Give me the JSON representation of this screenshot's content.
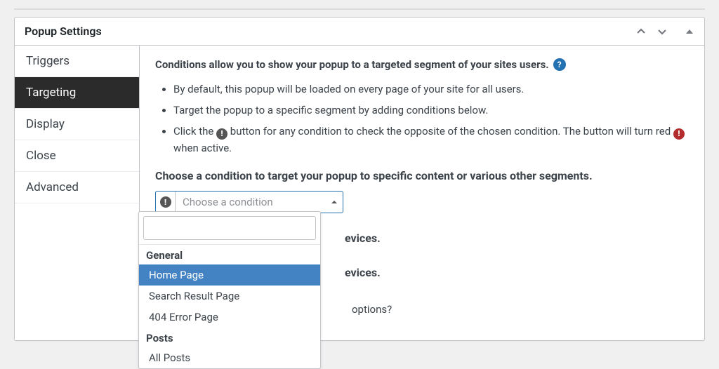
{
  "panel": {
    "title": "Popup Settings"
  },
  "tabs": {
    "items": [
      {
        "label": "Triggers"
      },
      {
        "label": "Targeting"
      },
      {
        "label": "Display"
      },
      {
        "label": "Close"
      },
      {
        "label": "Advanced"
      }
    ]
  },
  "content": {
    "intro": "Conditions allow you to show your popup to a targeted segment of your sites users.",
    "bullets": {
      "b1": "By default, this popup will be loaded on every page of your site for all users.",
      "b2": "Target the popup to a specific segment by adding conditions below.",
      "b3_a": "Click the ",
      "b3_b": " button for any condition to check the opposite of the chosen condition. The button will turn red ",
      "b3_c": " when active."
    },
    "condition_heading": "Choose a condition to target your popup to specific content or various other segments.",
    "combo_placeholder": "Choose a condition",
    "partial_line1": "evices.",
    "partial_line2": "evices.",
    "partial_line3": "options?"
  },
  "dropdown": {
    "groups": [
      {
        "label": "General",
        "options": [
          {
            "label": "Home Page",
            "selected": true
          },
          {
            "label": "Search Result Page"
          },
          {
            "label": "404 Error Page"
          }
        ]
      },
      {
        "label": "Posts",
        "options": [
          {
            "label": "All Posts"
          }
        ]
      }
    ]
  }
}
